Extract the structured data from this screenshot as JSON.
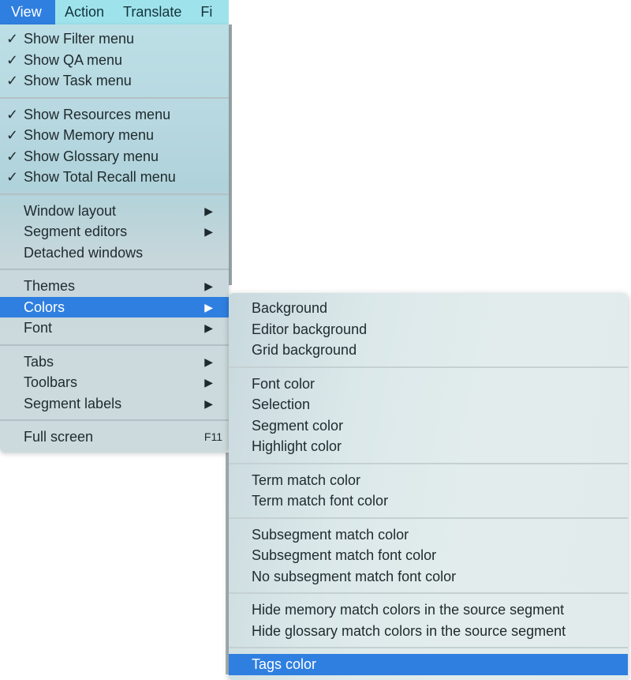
{
  "menubar": {
    "items": [
      {
        "label": "View",
        "active": true
      },
      {
        "label": "Action",
        "active": false
      },
      {
        "label": "Translate",
        "active": false
      },
      {
        "label": "Fi",
        "active": false
      }
    ]
  },
  "view_menu": {
    "groups": [
      [
        {
          "label": "Show Filter menu",
          "checked": true
        },
        {
          "label": "Show QA menu",
          "checked": true
        },
        {
          "label": "Show Task menu",
          "checked": true
        }
      ],
      [
        {
          "label": "Show Resources menu",
          "checked": true
        },
        {
          "label": "Show Memory menu",
          "checked": true
        },
        {
          "label": "Show Glossary menu",
          "checked": true
        },
        {
          "label": "Show Total Recall menu",
          "checked": true
        }
      ],
      [
        {
          "label": "Window layout",
          "submenu": true
        },
        {
          "label": "Segment editors",
          "submenu": true
        },
        {
          "label": "Detached windows"
        }
      ],
      [
        {
          "label": "Themes",
          "submenu": true
        },
        {
          "label": "Colors",
          "submenu": true,
          "highlighted": true
        },
        {
          "label": "Font",
          "submenu": true
        }
      ],
      [
        {
          "label": "Tabs",
          "submenu": true
        },
        {
          "label": "Toolbars",
          "submenu": true
        },
        {
          "label": "Segment labels",
          "submenu": true
        }
      ],
      [
        {
          "label": "Full screen",
          "shortcut": "F11"
        }
      ]
    ]
  },
  "colors_submenu": {
    "groups": [
      [
        {
          "label": "Background"
        },
        {
          "label": "Editor background"
        },
        {
          "label": "Grid background"
        }
      ],
      [
        {
          "label": "Font color"
        },
        {
          "label": "Selection"
        },
        {
          "label": "Segment color"
        },
        {
          "label": "Highlight color"
        }
      ],
      [
        {
          "label": "Term match color"
        },
        {
          "label": "Term match font color"
        }
      ],
      [
        {
          "label": "Subsegment match color"
        },
        {
          "label": "Subsegment match font color"
        },
        {
          "label": "No subsegment match font color"
        }
      ],
      [
        {
          "label": "Hide memory match colors in the source segment"
        },
        {
          "label": "Hide glossary match colors in the source segment"
        }
      ],
      [
        {
          "label": "Tags color",
          "highlighted": true
        }
      ]
    ]
  },
  "icons": {
    "check": "✓",
    "submenu_arrow": "▶"
  },
  "colors": {
    "highlight": "#2f7fe0",
    "menubar_bg": "#9ee3ec"
  }
}
